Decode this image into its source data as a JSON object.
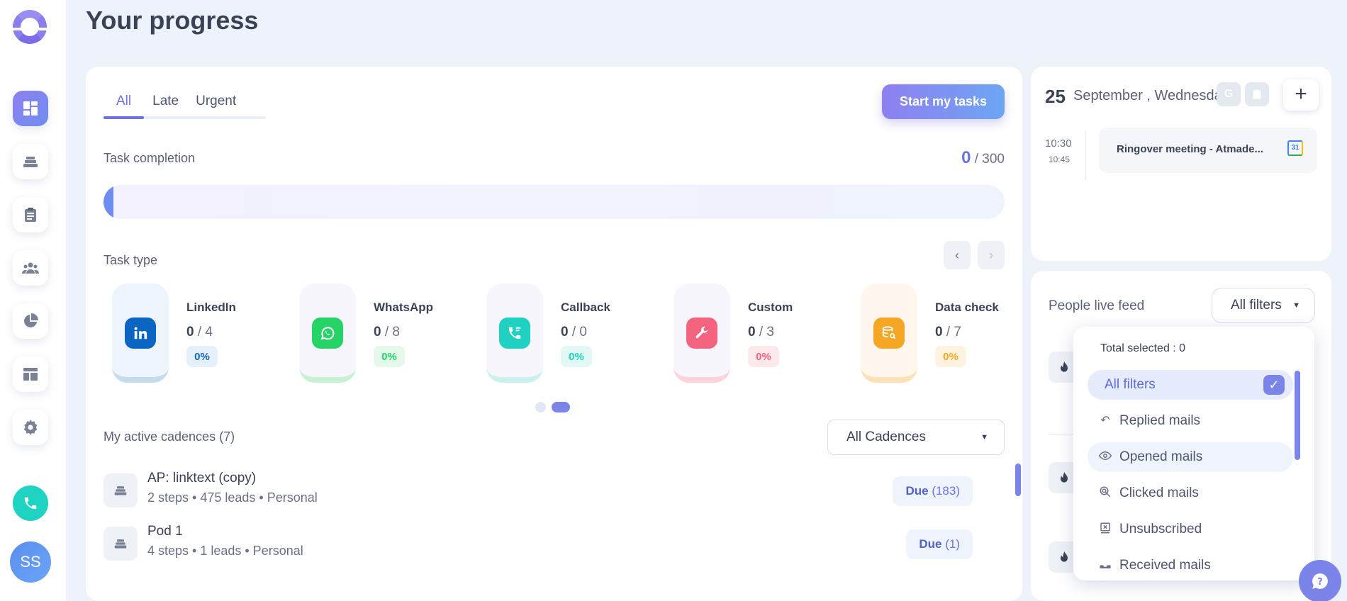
{
  "app": {
    "page_title": "Your progress",
    "avatar_initials": "SS"
  },
  "sidebar": {
    "items": [
      {
        "name": "dashboard-icon",
        "active": true
      },
      {
        "name": "cadences-icon",
        "active": false
      },
      {
        "name": "tasks-clipboard-icon",
        "active": false
      },
      {
        "name": "people-icon",
        "active": false
      },
      {
        "name": "analytics-pie-icon",
        "active": false
      },
      {
        "name": "templates-layout-icon",
        "active": false
      },
      {
        "name": "settings-gear-icon",
        "active": false
      }
    ]
  },
  "main": {
    "tabs": [
      {
        "label": "All",
        "active": true
      },
      {
        "label": "Late",
        "active": false
      },
      {
        "label": "Urgent",
        "active": false
      }
    ],
    "start_button": "Start my tasks",
    "task_completion": {
      "label": "Task completion",
      "done": "0",
      "total": " / 300",
      "fraction": 0.0
    },
    "task_type_label": "Task type",
    "task_types": [
      {
        "name": "LinkedIn",
        "done": "0",
        "total": " / 4",
        "pct": "0%",
        "color": "#0a66c2",
        "bg": "#e6f0fa",
        "pill": "#eef4fb",
        "accent": "#c5dbee"
      },
      {
        "name": "WhatsApp",
        "done": "0",
        "total": " / 8",
        "pct": "0%",
        "color": "#25d366",
        "bg": "#e5f8ec",
        "pill": "#f7f6fc",
        "accent": "#c9f0d6"
      },
      {
        "name": "Callback",
        "done": "0",
        "total": " / 0",
        "pct": "0%",
        "color": "#20d0c0",
        "bg": "#e2f8f5",
        "pill": "#f7f6fc",
        "accent": "#cbf1ee"
      },
      {
        "name": "Custom",
        "done": "0",
        "total": " / 3",
        "pct": "0%",
        "color": "#f5647e",
        "bg": "#fde8ec",
        "pill": "#f7f6fc",
        "accent": "#fbd3db"
      },
      {
        "name": "Data check",
        "done": "0",
        "total": " / 7",
        "pct": "0%",
        "color": "#f5a623",
        "bg": "#fef3de",
        "pill": "#fff7ee",
        "accent": "#fde0b6"
      }
    ],
    "cadences": {
      "label": "My active cadences (7)",
      "filter_value": "All Cadences",
      "items": [
        {
          "name": "AP: linktext (copy)",
          "meta": "2 steps • 475 leads • Personal",
          "due_label": "Due",
          "due_count": "(183)"
        },
        {
          "name": "Pod 1",
          "meta": "4 steps • 1 leads • Personal",
          "due_label": "Due",
          "due_count": "(1)"
        }
      ]
    }
  },
  "calendar": {
    "day": "25",
    "date_text": "September , Wednesday",
    "google_letter": "G",
    "add_label": "+",
    "event": {
      "start": "10:30",
      "end": "10:45",
      "title": "Ringover meeting - Atmade...",
      "gcal_label": "31"
    }
  },
  "live_feed": {
    "title": "People live feed",
    "filter_button": "All filters",
    "dropdown": {
      "total_selected": "Total selected : 0",
      "items": [
        {
          "label": "All filters",
          "icon": "none",
          "selected": true
        },
        {
          "label": "Replied mails",
          "icon": "reply-icon"
        },
        {
          "label": "Opened mails",
          "icon": "eye-icon"
        },
        {
          "label": "Clicked mails",
          "icon": "cursor-click-icon"
        },
        {
          "label": "Unsubscribed",
          "icon": "unsubscribe-icon"
        },
        {
          "label": "Received mails",
          "icon": "inbox-icon"
        }
      ]
    }
  }
}
